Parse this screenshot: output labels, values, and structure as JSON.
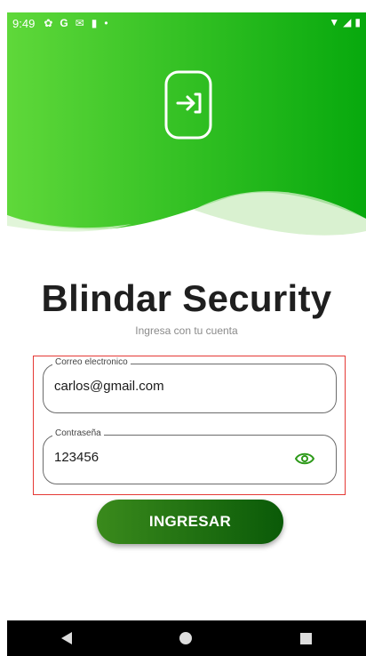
{
  "status_bar": {
    "time": "9:49",
    "icons": [
      "gear-icon",
      "g-icon",
      "gmail-icon",
      "sd-icon",
      "dot-icon"
    ],
    "right_icons": [
      "wifi-icon",
      "signal-icon",
      "battery-icon"
    ]
  },
  "header": {
    "gradient": [
      "#5fd83a",
      "#07a90d"
    ],
    "icon": "login-icon"
  },
  "brand": {
    "title": "Blindar Security",
    "subtitle": "Ingresa con tu cuenta"
  },
  "form": {
    "email": {
      "label": "Correo electronico",
      "value": "carlos@gmail.com"
    },
    "password": {
      "label": "Contraseña",
      "value": "123456"
    }
  },
  "actions": {
    "login_label": "INGRESAR"
  },
  "nav": {
    "icons": [
      "back-icon",
      "home-icon",
      "recent-apps-icon"
    ]
  },
  "colors": {
    "accent": "#2e9a1a",
    "error_outline": "#e53935"
  }
}
